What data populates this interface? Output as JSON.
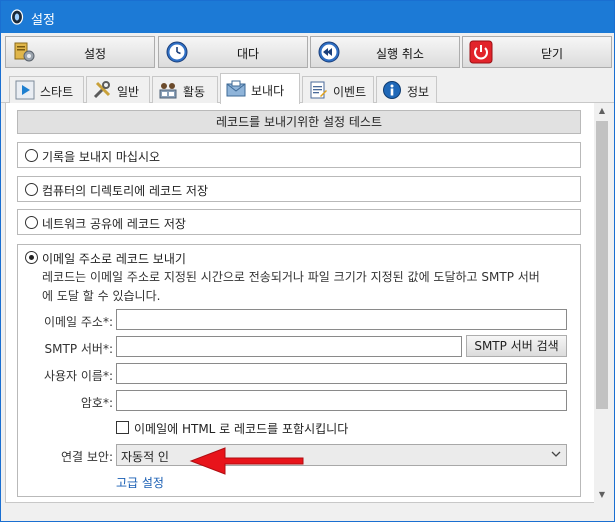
{
  "window": {
    "title": "설정"
  },
  "toolbar": {
    "settings_label": "설정",
    "wait_label": "대다",
    "undo_label": "실행 취소",
    "close_label": "닫기"
  },
  "tabs": [
    {
      "label": "스타트"
    },
    {
      "label": "일반"
    },
    {
      "label": "활동"
    },
    {
      "label": "보내다"
    },
    {
      "label": "이벤트"
    },
    {
      "label": "정보"
    }
  ],
  "panel": {
    "header": "레코드를 보내기위한 설정 테스트",
    "options": [
      {
        "label": "기록을 보내지 마십시오",
        "checked": false
      },
      {
        "label": "컴퓨터의 디렉토리에 레코드 저장",
        "checked": false
      },
      {
        "label": "네트워크 공유에 레코드 저장",
        "checked": false
      },
      {
        "label": "이메일 주소로 레코드 보내기",
        "checked": true
      }
    ],
    "email_desc_line1": "레코드는 이메일 주소로 지정된 시간으로 전송되거나 파일 크기가 지정된 값에 도달하고 SMTP 서버",
    "email_desc_line2": "에 도달 할 수 있습니다."
  },
  "form": {
    "email_label": "이메일 주소*:",
    "email_value": "",
    "smtp_label": "SMTP 서버*:",
    "smtp_value": "",
    "smtp_search_label": "SMTP 서버 검색",
    "username_label": "사용자 이름*:",
    "username_value": "",
    "password_label": "암호*:",
    "password_value": "",
    "html_checkbox_label": "이메일에 HTML 로 레코드를 포함시킵니다",
    "html_checkbox_checked": false,
    "security_label": "연결 보안:",
    "security_value": "자동적 인",
    "advanced_link": "고급 설정"
  },
  "colors": {
    "titlebar": "#1c7ad6",
    "link": "#1a5fb4",
    "arrow": "#e8141b"
  }
}
